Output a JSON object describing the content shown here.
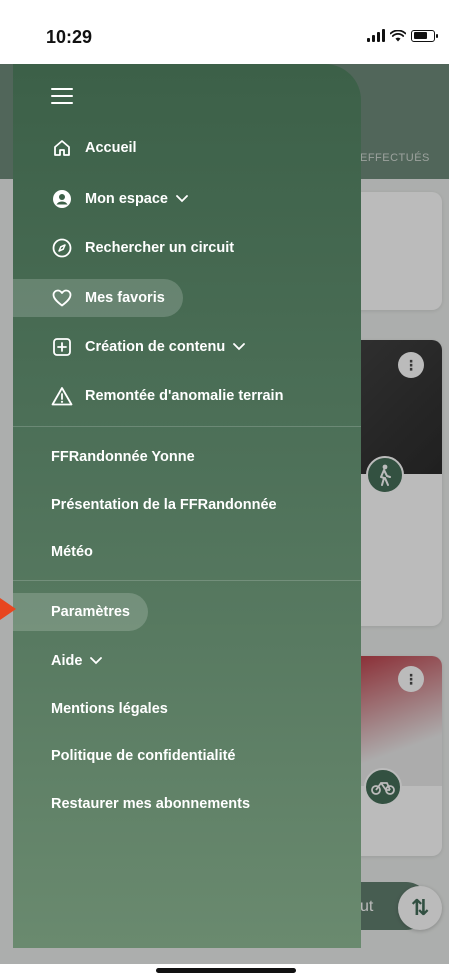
{
  "status_bar": {
    "time": "10:29"
  },
  "background": {
    "tab_label": "EFFECTUÉS",
    "bottom_button_label": "ut",
    "sort_icon": "sort-arrows-icon"
  },
  "drawer": {
    "menu_icon": "hamburger-icon",
    "primary_items": [
      {
        "label": "Accueil",
        "icon": "home-icon"
      },
      {
        "label": "Mon espace",
        "icon": "user-circle-icon",
        "has_chevron": true
      },
      {
        "label": "Rechercher un circuit",
        "icon": "compass-icon"
      },
      {
        "label": "Mes favoris",
        "icon": "heart-icon",
        "active": true
      },
      {
        "label": "Création de contenu",
        "icon": "plus-square-icon",
        "has_chevron": true
      },
      {
        "label": "Remontée d'anomalie terrain",
        "icon": "warning-icon"
      }
    ],
    "secondary_items": [
      {
        "label": "FFRandonnée Yonne"
      },
      {
        "label": "Présentation de la FFRandonnée"
      },
      {
        "label": "Météo"
      }
    ],
    "tertiary_items": [
      {
        "label": "Paramètres",
        "active": true
      },
      {
        "label": "Aide",
        "has_chevron": true
      },
      {
        "label": "Mentions légales"
      },
      {
        "label": "Politique de confidentialité"
      },
      {
        "label": "Restaurer mes abonnements"
      }
    ]
  },
  "colors": {
    "drawer_top": "#3c6048",
    "drawer_bottom": "#6a8a6f",
    "pointer_arrow": "#e8461f"
  }
}
